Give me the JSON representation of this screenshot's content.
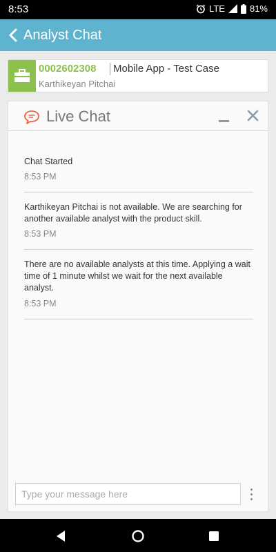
{
  "status_bar": {
    "time": "8:53",
    "network": "LTE",
    "battery": "81%"
  },
  "app_bar": {
    "title": "Analyst Chat"
  },
  "case": {
    "number": "0002602308",
    "title": "Mobile App - Test Case",
    "person": "Karthikeyan Pitchai"
  },
  "chat": {
    "title": "Live Chat",
    "messages": [
      {
        "text": "Chat Started",
        "time": "8:53 PM"
      },
      {
        "text": "Karthikeyan Pitchai is not available. We are searching for another available analyst with the product skill.",
        "time": "8:53 PM"
      },
      {
        "text": "There are no available analysts at this time. Applying a wait time of 1 minute whilst we wait for the next available analyst.",
        "time": "8:53 PM"
      }
    ],
    "input_placeholder": "Type your message here",
    "input_value": ""
  },
  "colors": {
    "app_bar": "#5eb4cf",
    "case_accent": "#8cc04d",
    "chat_icon": "#f0643c"
  },
  "icons": [
    "alarm-icon",
    "signal-icon",
    "battery-icon",
    "back-chevron-icon",
    "briefcase-icon",
    "chat-bubble-icon",
    "minimize-icon",
    "close-icon",
    "more-vert-icon",
    "nav-back-icon",
    "nav-home-icon",
    "nav-recents-icon"
  ]
}
